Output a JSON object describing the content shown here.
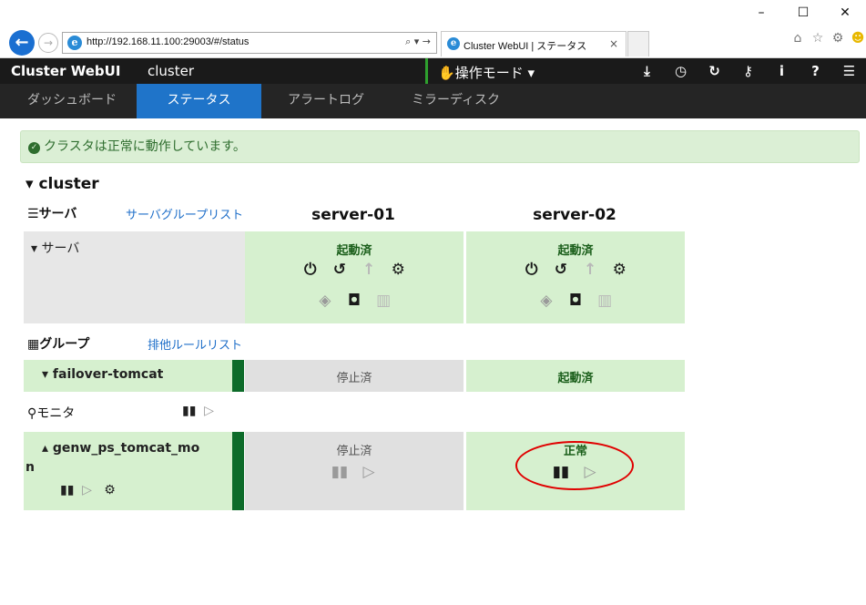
{
  "browser": {
    "url": "http://192.168.11.100:29003/#/status",
    "tab_title": "Cluster WebUI | ステータス",
    "tab_close": "×",
    "addr_tools": "⌕ ▾ →",
    "window_controls": [
      "–",
      "☐",
      "✕"
    ],
    "tools": [
      "home-icon",
      "star-icon",
      "gear-icon",
      "smiley-icon"
    ]
  },
  "app": {
    "brand": "Cluster WebUI",
    "cluster_name": "cluster",
    "mode_label": "操作モード",
    "toolbar_icons": [
      "download-icon",
      "clock-icon",
      "refresh-icon",
      "key-icon",
      "info-icon",
      "help-icon",
      "menu-icon"
    ]
  },
  "nav": {
    "tabs": [
      "ダッシュボード",
      "ステータス",
      "アラートログ",
      "ミラーディスク"
    ],
    "active": "ステータス"
  },
  "alert": {
    "text": "クラスタは正常に動作しています。"
  },
  "cluster": {
    "title": "cluster",
    "server_section": {
      "label": "サーバ",
      "link": "サーバグループリスト"
    },
    "servers": [
      "server-01",
      "server-02"
    ],
    "server_row": {
      "label": "サーバ",
      "statuses": [
        "起動済",
        "起動済"
      ]
    },
    "group_section": {
      "label": "グループ",
      "link": "排他ルールリスト"
    },
    "group_row": {
      "name": "failover-tomcat",
      "statuses": [
        "停止済",
        "起動済"
      ]
    },
    "monitor_section": {
      "label": "モニタ"
    },
    "monitor_row": {
      "name_line1": "genw_ps_tomcat_mo",
      "name_line2": "n",
      "statuses": [
        "停止済",
        "正常"
      ]
    }
  },
  "colors": {
    "running_bg": "#d6f0cf",
    "stopped_bg": "#e0e0e0",
    "active_tab": "#1f74c9",
    "highlight_ellipse": "#e00000"
  }
}
